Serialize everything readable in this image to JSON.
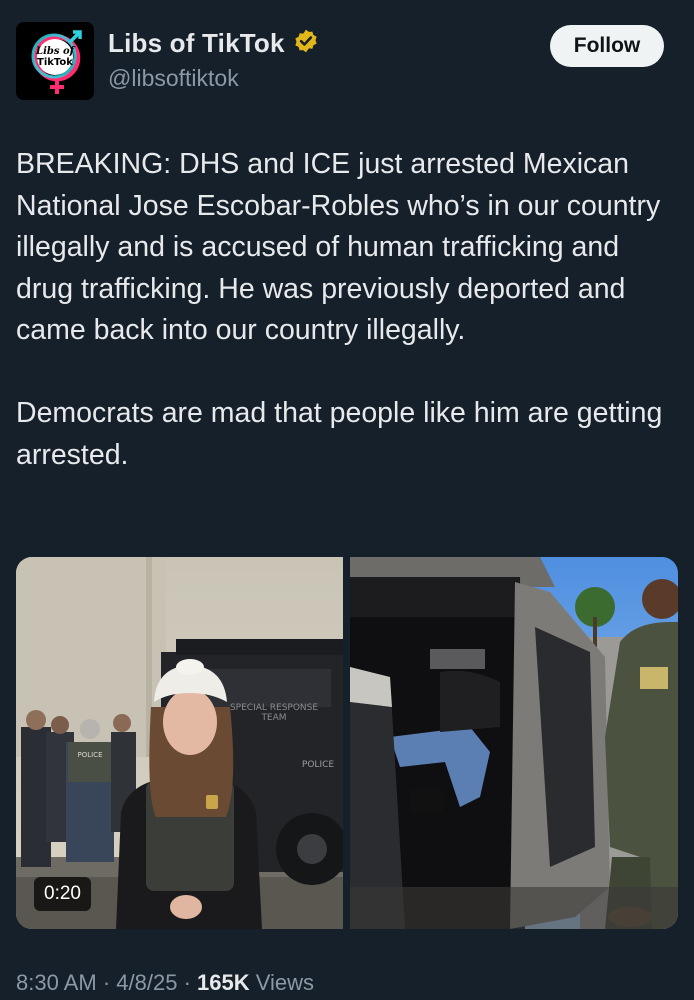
{
  "account": {
    "avatar_text": [
      "Libs of",
      "TikTok"
    ],
    "display_name": "Libs of TikTok",
    "handle": "@libsoftiktok",
    "verified_badge_color": "#e2b719"
  },
  "actions": {
    "follow_label": "Follow"
  },
  "tweet": {
    "text": "BREAKING: DHS and ICE just arrested Mexican National Jose Escobar-Robles who’s in our country illegally and is accused of human trafficking and drug trafficking. He was previously deported and came back into our country illegally.\n\nDemocrats are mad that people like him are getting arrested."
  },
  "media": {
    "video": {
      "duration": "0:20",
      "vehicle_text": [
        "SPECIAL RESPONSE",
        "TEAM",
        "POLICE"
      ],
      "vest_text": "POLICE"
    },
    "photo": {}
  },
  "meta": {
    "time": "8:30 AM",
    "separator": " · ",
    "date": "4/8/25",
    "views_count": "165K",
    "views_label": " Views"
  },
  "colors": {
    "background": "#15202b",
    "text_primary": "#e7e9ea",
    "text_secondary": "#8b98a5",
    "follow_bg": "#eff3f4"
  }
}
